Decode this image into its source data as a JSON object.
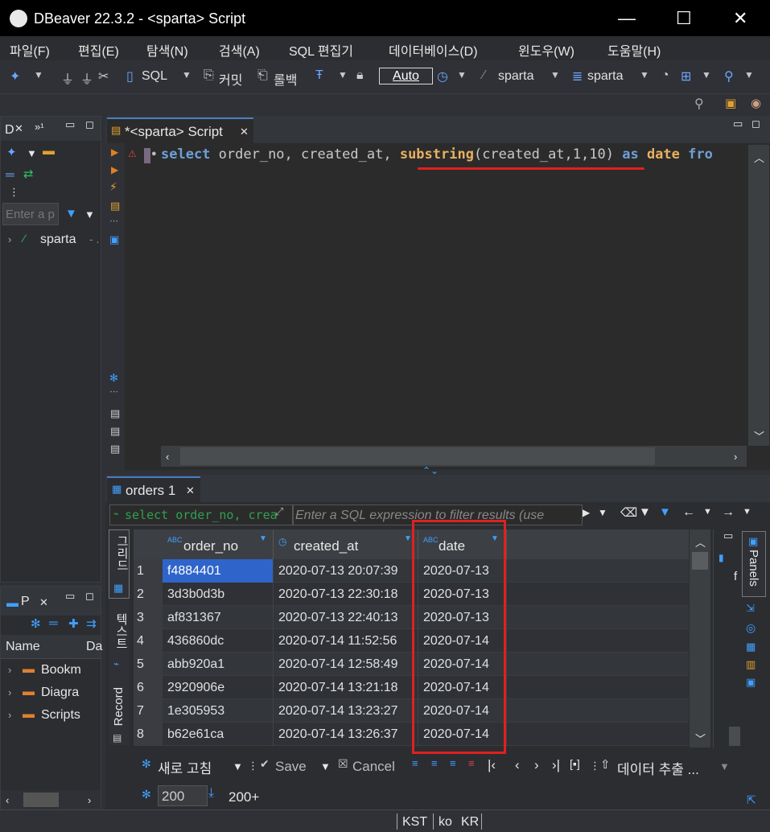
{
  "window": {
    "title": "DBeaver 22.3.2 - <sparta> Script",
    "minimize": "—",
    "maximize": "☐",
    "close": "✕"
  },
  "menu": [
    "파일(F)",
    "편집(E)",
    "탐색(N)",
    "검색(A)",
    "SQL 편집기",
    "데이터베이스(D)",
    "윈도우(W)",
    "도움말(H)"
  ],
  "toolbar": {
    "sql_label": "SQL",
    "commit_label": "커밋",
    "rollback_label": "롤백",
    "auto_label": "Auto",
    "datasource_label": "sparta",
    "schema_label": "sparta"
  },
  "left": {
    "tab_label": "D",
    "filter_placeholder": "Enter a p",
    "tree_item": "sparta",
    "tree_item_suffix": "- .",
    "projects_tab": "P",
    "col_name": "Name",
    "col_da": "Da",
    "items": [
      "Bookm",
      "Diagra",
      "Scripts"
    ]
  },
  "editor": {
    "tab_label": "*<sparta> Script",
    "sql": {
      "kw_select": "select",
      "cols": " order_no, created_at, ",
      "fn": "substring",
      "args": "(created_at,1,10)",
      "kw_as": "as",
      "alias": "date",
      "kw_from": "fro"
    }
  },
  "results": {
    "tab_label": "orders 1",
    "filter_sql": "select order_no, creat",
    "filter_placeholder": "Enter a SQL expression to filter results (use",
    "side_tabs": {
      "grid": "그리드",
      "text": "텍스트",
      "record": "Record"
    },
    "panels_label": "Panels",
    "panels_item": "f",
    "columns": [
      "order_no",
      "created_at",
      "date"
    ],
    "rows": [
      {
        "n": "1",
        "order_no": "f4884401",
        "created_at": "2020-07-13 20:07:39",
        "date": "2020-07-13"
      },
      {
        "n": "2",
        "order_no": "3d3b0d3b",
        "created_at": "2020-07-13 22:30:18",
        "date": "2020-07-13"
      },
      {
        "n": "3",
        "order_no": "af831367",
        "created_at": "2020-07-13 22:40:13",
        "date": "2020-07-13"
      },
      {
        "n": "4",
        "order_no": "436860dc",
        "created_at": "2020-07-14 11:52:56",
        "date": "2020-07-14"
      },
      {
        "n": "5",
        "order_no": "abb920a1",
        "created_at": "2020-07-14 12:58:49",
        "date": "2020-07-14"
      },
      {
        "n": "6",
        "order_no": "2920906e",
        "created_at": "2020-07-14 13:21:18",
        "date": "2020-07-14"
      },
      {
        "n": "7",
        "order_no": "1e305953",
        "created_at": "2020-07-14 13:23:27",
        "date": "2020-07-14"
      },
      {
        "n": "8",
        "order_no": "b62e61ca",
        "created_at": "2020-07-14 13:26:37",
        "date": "2020-07-14"
      }
    ],
    "bottom": {
      "refresh": "새로 고침",
      "save": "Save",
      "cancel": "Cancel",
      "export": "데이터 추출 ...",
      "fetch_size": "200",
      "fetch_count": "200+"
    }
  },
  "status": {
    "tz": "KST",
    "locale": "ko",
    "region": "KR"
  },
  "colors": {
    "highlight": "#e02020",
    "selected_cell": "#2f65ca",
    "keyword": "#6f9fd8"
  }
}
